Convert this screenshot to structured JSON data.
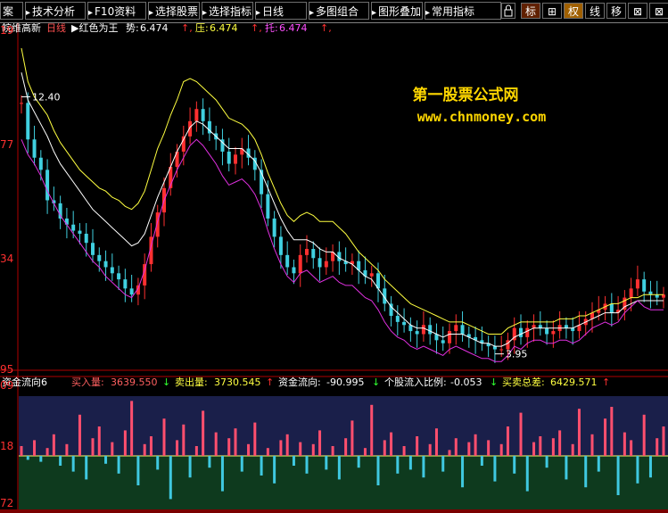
{
  "toolbar": {
    "items": [
      "案",
      "技术分析",
      "F10资料",
      "选择股票",
      "选择指标",
      "日线",
      "多图组合",
      "图形叠加",
      "常用指标"
    ],
    "buttons": [
      "标",
      "⊞",
      "权",
      "线",
      "移",
      "⊠",
      "⊠"
    ]
  },
  "colors": {
    "up": "#ff3030",
    "down": "#40d0e0",
    "ma_yellow": "#ffff40",
    "ma_white": "#ffffff",
    "ma_magenta": "#e030e0",
    "flow_pos": "#ff4f6e",
    "flow_neg": "#3fc8e0",
    "accent_gold": "#ffd700",
    "text_yellow": "#ffff00"
  },
  "main": {
    "stock_name": "皖维高新",
    "period": "日线",
    "indicator_name": "红色为王",
    "metrics": [
      {
        "label": "势:",
        "value": "6.474",
        "color": "#ffffff"
      },
      {
        "label": "压:",
        "value": "6.474",
        "color": "#ffff40"
      },
      {
        "label": "托:",
        "value": "6.474",
        "color": "#ff50ff"
      }
    ],
    "y_ticks": [
      "19",
      "77",
      "34",
      "95"
    ],
    "high_label": "12.40",
    "low_label": "3.95",
    "watermark": {
      "line1": "第一股票公式网",
      "line2": "www.chnmoney.com"
    }
  },
  "sub": {
    "name": "资金流向6",
    "metrics": [
      {
        "label": "买入量:",
        "value": "3639.550",
        "arrow": "↓",
        "color": "#ff6060"
      },
      {
        "label": "卖出量:",
        "value": "3730.545",
        "arrow": "↑",
        "color": "#ffff40"
      },
      {
        "label": "资金流向:",
        "value": "-90.995",
        "arrow": "↓",
        "color": "#ffffff"
      },
      {
        "label": "个股流入比例:",
        "value": "-0.053",
        "arrow": "↓",
        "color": "#ffffff"
      },
      {
        "label": "买卖总差:",
        "value": "6429.571",
        "arrow": "↑",
        "color": "#ffff40"
      }
    ],
    "y_ticks": [
      "09",
      "18",
      "72"
    ]
  },
  "chart_data": [
    {
      "type": "candlestick",
      "title": "皖维高新 日线",
      "ylim": [
        3.5,
        14.0
      ],
      "grid": false,
      "high_annotation": 12.4,
      "low_annotation": 3.95,
      "series": [
        {
          "name": "close",
          "values": [
            12.2,
            11.0,
            10.4,
            10.0,
            9.0,
            8.9,
            8.4,
            8.2,
            8.0,
            7.9,
            7.6,
            7.2,
            7.0,
            6.8,
            6.6,
            6.4,
            6.1,
            5.9,
            6.2,
            6.9,
            7.8,
            8.6,
            9.4,
            10.1,
            10.6,
            11.1,
            11.6,
            12.0,
            11.6,
            11.2,
            11.0,
            10.6,
            10.2,
            10.5,
            10.7,
            10.4,
            10.0,
            9.2,
            8.4,
            7.8,
            7.2,
            6.8,
            6.6,
            7.2,
            7.4,
            7.1,
            6.8,
            7.0,
            7.3,
            7.0,
            6.9,
            7.0,
            6.7,
            6.5,
            6.6,
            6.1,
            5.6,
            5.2,
            5.0,
            4.9,
            4.7,
            4.6,
            4.9,
            4.6,
            4.4,
            4.3,
            4.7,
            4.9,
            4.6,
            4.5,
            4.4,
            4.3,
            4.2,
            4.1,
            4.1,
            4.4,
            4.8,
            4.5,
            4.8,
            4.9,
            4.8,
            4.6,
            4.7,
            4.9,
            4.8,
            4.7,
            4.9,
            5.1,
            5.3,
            5.4,
            5.6,
            5.3,
            5.4,
            5.8,
            6.1,
            6.4,
            6.0,
            5.9,
            5.8,
            5.9
          ]
        },
        {
          "name": "壓",
          "values": [
            14.0,
            12.9,
            12.4,
            12.1,
            11.8,
            11.3,
            10.9,
            10.6,
            10.3,
            10.0,
            9.8,
            9.6,
            9.4,
            9.3,
            9.1,
            9.0,
            8.8,
            8.7,
            8.9,
            9.3,
            10.0,
            10.7,
            11.2,
            11.8,
            12.3,
            12.9,
            13.0,
            12.9,
            12.7,
            12.5,
            12.3,
            12.0,
            11.7,
            11.6,
            11.5,
            11.3,
            11.0,
            10.5,
            9.9,
            9.4,
            8.9,
            8.5,
            8.3,
            8.5,
            8.6,
            8.5,
            8.3,
            8.3,
            8.3,
            8.1,
            7.9,
            7.6,
            7.3,
            7.1,
            6.9,
            6.7,
            6.4,
            6.2,
            6.0,
            5.8,
            5.6,
            5.5,
            5.4,
            5.3,
            5.2,
            5.1,
            5.0,
            5.0,
            5.0,
            4.9,
            4.8,
            4.7,
            4.6,
            4.6,
            4.6,
            4.8,
            4.9,
            5.0,
            5.0,
            5.0,
            5.0,
            5.0,
            5.0,
            5.1,
            5.1,
            5.1,
            5.2,
            5.2,
            5.3,
            5.4,
            5.5,
            5.6,
            5.6,
            5.7,
            5.8,
            5.8,
            5.9,
            5.9,
            5.9,
            5.9
          ]
        },
        {
          "name": "勢",
          "values": [
            13.2,
            12.3,
            11.9,
            11.5,
            11.1,
            10.6,
            10.2,
            9.9,
            9.6,
            9.3,
            9.0,
            8.7,
            8.5,
            8.3,
            8.1,
            7.9,
            7.7,
            7.5,
            7.6,
            7.9,
            8.5,
            9.1,
            9.6,
            10.1,
            10.6,
            11.0,
            11.4,
            11.6,
            11.5,
            11.3,
            11.1,
            10.9,
            10.7,
            10.7,
            10.7,
            10.5,
            10.3,
            9.9,
            9.4,
            8.9,
            8.4,
            8.0,
            7.7,
            7.7,
            7.7,
            7.6,
            7.4,
            7.3,
            7.3,
            7.1,
            7.0,
            6.9,
            6.7,
            6.5,
            6.4,
            6.1,
            5.8,
            5.5,
            5.3,
            5.1,
            4.9,
            4.8,
            4.8,
            4.7,
            4.6,
            4.5,
            4.6,
            4.6,
            4.6,
            4.5,
            4.4,
            4.3,
            4.3,
            4.2,
            4.2,
            4.3,
            4.5,
            4.6,
            4.7,
            4.8,
            4.8,
            4.8,
            4.8,
            4.8,
            4.8,
            4.8,
            4.9,
            5.0,
            5.1,
            5.2,
            5.3,
            5.3,
            5.3,
            5.5,
            5.6,
            5.7,
            5.7,
            5.7,
            5.7,
            5.7
          ]
        },
        {
          "name": "托",
          "values": [
            11.0,
            10.5,
            10.2,
            9.8,
            9.3,
            8.9,
            8.5,
            8.2,
            7.9,
            7.6,
            7.3,
            7.0,
            6.8,
            6.5,
            6.3,
            6.1,
            5.9,
            5.8,
            6.1,
            6.7,
            7.5,
            8.3,
            9.0,
            9.5,
            10.0,
            10.4,
            10.8,
            11.0,
            10.8,
            10.5,
            10.2,
            9.8,
            9.5,
            9.6,
            9.7,
            9.5,
            9.2,
            8.7,
            8.0,
            7.4,
            6.9,
            6.5,
            6.3,
            6.6,
            6.7,
            6.5,
            6.3,
            6.4,
            6.5,
            6.3,
            6.2,
            6.2,
            6.0,
            5.8,
            5.7,
            5.4,
            5.0,
            4.7,
            4.5,
            4.4,
            4.2,
            4.1,
            4.2,
            4.1,
            4.0,
            3.9,
            4.1,
            4.2,
            4.1,
            4.0,
            3.9,
            3.8,
            3.8,
            3.7,
            3.7,
            3.9,
            4.2,
            4.1,
            4.3,
            4.4,
            4.4,
            4.3,
            4.3,
            4.4,
            4.4,
            4.3,
            4.4,
            4.6,
            4.8,
            4.9,
            5.0,
            4.9,
            5.0,
            5.3,
            5.5,
            5.7,
            5.5,
            5.4,
            5.4,
            5.4
          ]
        }
      ]
    },
    {
      "type": "bar",
      "title": "资金流向6",
      "series": [
        {
          "name": "资金流向",
          "values": [
            0.5,
            -0.2,
            0.8,
            -0.3,
            0.4,
            1.1,
            -0.5,
            0.6,
            -0.8,
            2.1,
            -1.2,
            0.9,
            1.5,
            -0.4,
            0.7,
            -0.9,
            1.3,
            2.8,
            -1.5,
            0.6,
            1.0,
            -0.7,
            1.9,
            -2.2,
            0.8,
            1.6,
            -1.1,
            0.5,
            2.3,
            -0.6,
            1.2,
            -1.8,
            0.9,
            1.4,
            -0.8,
            0.6,
            1.7,
            -1.0,
            0.4,
            -1.4,
            0.8,
            1.1,
            -0.5,
            0.7,
            -0.9,
            0.6,
            1.3,
            -0.7,
            0.5,
            -1.2,
            0.9,
            1.8,
            -0.6,
            0.4,
            2.6,
            -1.5,
            0.8,
            1.2,
            -0.9,
            0.5,
            -0.7,
            1.0,
            -1.1,
            0.6,
            1.4,
            -0.8,
            0.3,
            0.9,
            -1.6,
            0.7,
            1.1,
            -0.5,
            0.8,
            -1.3,
            0.6,
            1.5,
            -0.9,
            2.2,
            -1.8,
            0.7,
            1.0,
            -0.6,
            0.9,
            1.3,
            -1.2,
            0.6,
            2.4,
            -1.6,
            1.1,
            -0.8,
            1.9,
            2.5,
            -2.0,
            1.2,
            0.8,
            -1.4,
            2.1,
            -1.1,
            0.9,
            1.5
          ]
        }
      ]
    }
  ]
}
